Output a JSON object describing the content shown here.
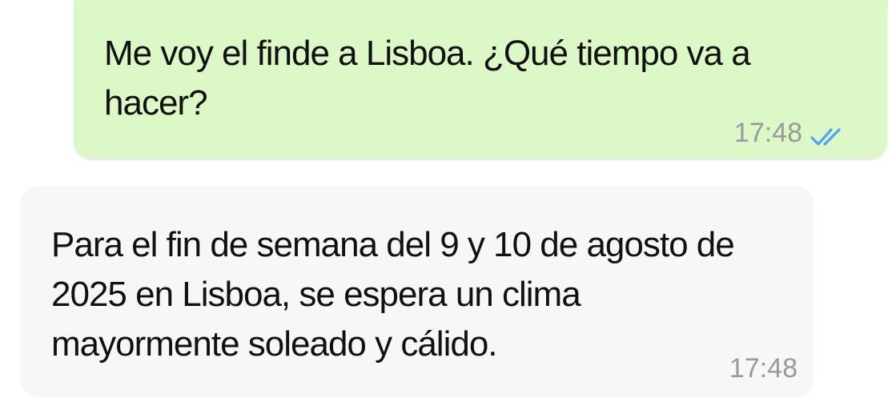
{
  "messages": [
    {
      "direction": "outgoing",
      "text": "Me voy el finde a Lisboa. ¿Qué tiempo va a hacer?",
      "time": "17:48",
      "status_icon": "double-check-read-icon",
      "bubble_color": "#dcf8c6",
      "tick_color": "#4fa3f7"
    },
    {
      "direction": "incoming",
      "text": "Para el fin de semana del 9 y 10 de agosto de 2025 en Lisboa, se espera un clima mayormente soleado y cálido.",
      "time": "17:48",
      "bubble_color": "#f7f7f7"
    }
  ]
}
